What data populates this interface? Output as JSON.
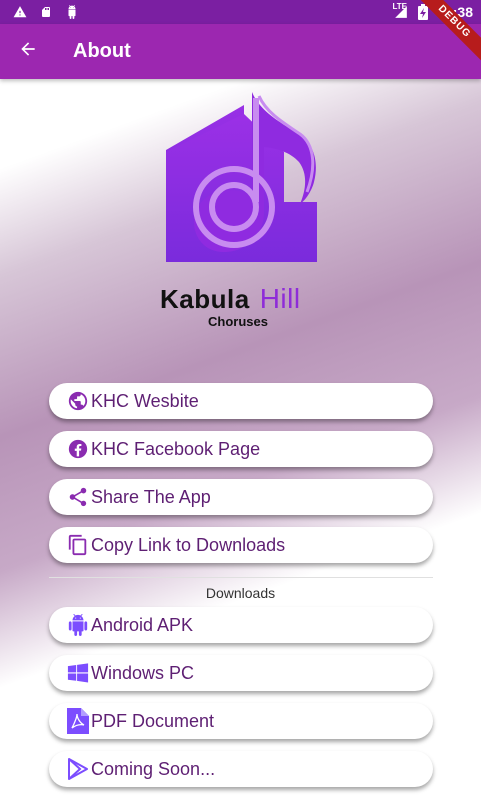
{
  "status_bar": {
    "time": "10:38",
    "network": "LTE"
  },
  "debug_banner": "DEBUG",
  "app_bar": {
    "title": "About"
  },
  "brand": {
    "name": "Kabula",
    "accent": "Hill",
    "subtitle": "Choruses"
  },
  "links": [
    {
      "label": "KHC Wesbite",
      "icon": "globe-icon"
    },
    {
      "label": "KHC Facebook Page",
      "icon": "facebook-icon"
    },
    {
      "label": "Share The App",
      "icon": "share-icon"
    },
    {
      "label": "Copy Link to Downloads",
      "icon": "copy-icon"
    }
  ],
  "downloads": {
    "label": "Downloads",
    "items": [
      {
        "label": "Android APK",
        "icon": "android-icon"
      },
      {
        "label": "Windows PC",
        "icon": "windows-icon"
      },
      {
        "label": "PDF Document",
        "icon": "pdf-icon"
      },
      {
        "label": "Coming Soon...",
        "icon": "play-store-icon"
      }
    ]
  },
  "colors": {
    "primary": "#9c27b0",
    "status_bar": "#7b1fa2",
    "accent": "#8e2cd8",
    "button_text": "#5e1f73"
  }
}
